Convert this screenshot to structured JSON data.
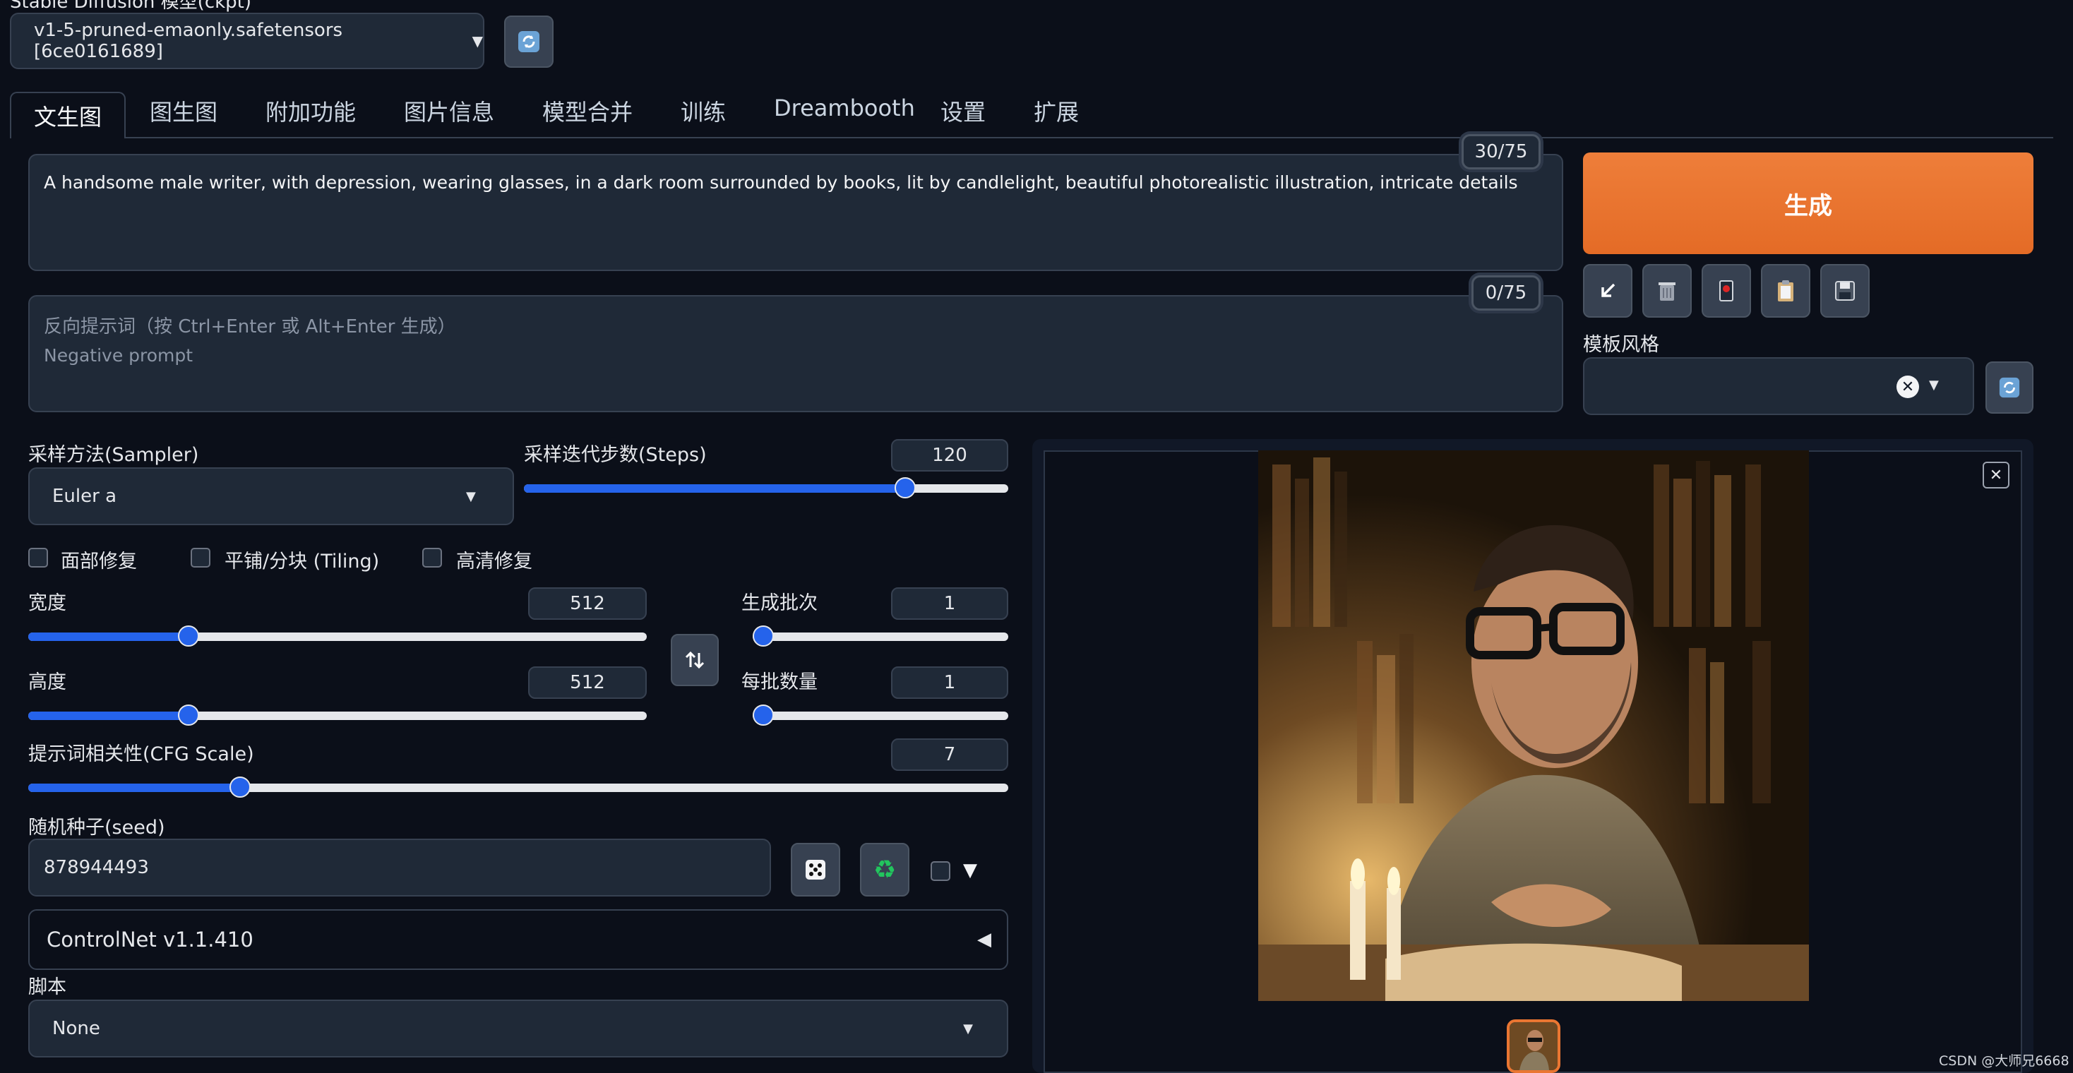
{
  "model": {
    "label": "Stable Diffusion 模型(ckpt)",
    "selected": "v1-5-pruned-emaonly.safetensors [6ce0161689]"
  },
  "tabs": [
    "文生图",
    "图生图",
    "附加功能",
    "图片信息",
    "模型合并",
    "训练",
    "Dreambooth",
    "设置",
    "扩展"
  ],
  "prompt": {
    "value": "A handsome male writer, with depression, wearing glasses, in a dark room surrounded by books, lit by candlelight, beautiful photorealistic illustration, intricate details",
    "counter": "30/75"
  },
  "negative": {
    "placeholder_line1": "反向提示词（按 Ctrl+Enter 或 Alt+Enter 生成）",
    "placeholder_line2": "Negative prompt",
    "counter": "0/75"
  },
  "generate_label": "生成",
  "style": {
    "label": "模板风格"
  },
  "sampler": {
    "label": "采样方法(Sampler)",
    "value": "Euler a"
  },
  "steps": {
    "label": "采样迭代步数(Steps)",
    "value": "120",
    "fraction": 0.8
  },
  "checkboxes": {
    "face": "面部修复",
    "tiling": "平铺/分块 (Tiling)",
    "hires": "高清修复"
  },
  "width": {
    "label": "宽度",
    "value": "512",
    "fraction": 0.25
  },
  "height": {
    "label": "高度",
    "value": "512",
    "fraction": 0.25
  },
  "batch_count": {
    "label": "生成批次",
    "value": "1",
    "fraction": 0.0
  },
  "batch_size": {
    "label": "每批数量",
    "value": "1",
    "fraction": 0.0
  },
  "cfg": {
    "label": "提示词相关性(CFG Scale)",
    "value": "7",
    "fraction": 0.21
  },
  "seed": {
    "label": "随机种子(seed)",
    "value": "878944493"
  },
  "controlnet": {
    "label": "ControlNet v1.1.410"
  },
  "script": {
    "label": "脚本",
    "value": "None"
  },
  "watermark": "CSDN @大师兄6668",
  "colors": {
    "accent": "#ea7632",
    "slider": "#2563eb",
    "bg": "#0b0f19"
  }
}
